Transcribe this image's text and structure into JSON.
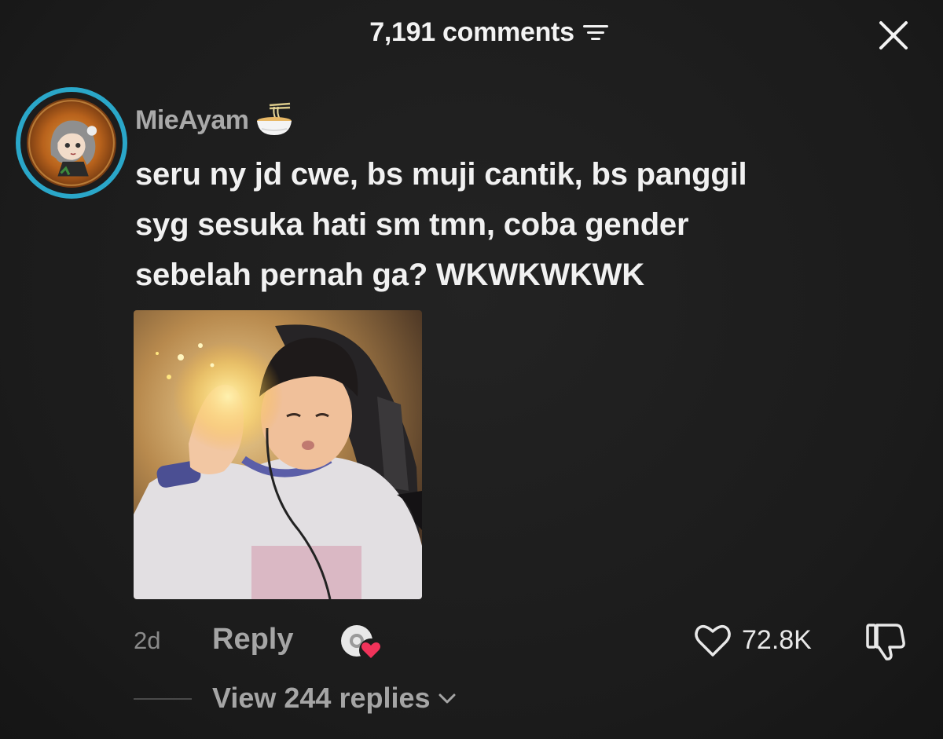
{
  "header": {
    "comments_count": "7,191 comments"
  },
  "comment": {
    "username": "MieAyam",
    "username_emoji": "noodle-bowl-icon",
    "lines": [
      "seru ny jd cwe, bs muji cantik, bs panggil",
      "syg sesuka hati sm tmn, coba gender",
      "sebelah pernah ga? WKWKWKWK"
    ],
    "timestamp": "2d",
    "reply_label": "Reply",
    "likes": "72.8K",
    "view_replies_label": "View 244 replies"
  },
  "icons": {
    "filter": "filter-icon",
    "close": "close-icon",
    "heart": "heart-icon",
    "dislike": "thumbs-down-icon",
    "creator_liked": "creator-liked-icon",
    "chevron": "chevron-down-icon"
  },
  "colors": {
    "background": "#1c1c1c",
    "avatar_ring": "#2aa7c9",
    "creator_heart": "#f0335a"
  }
}
